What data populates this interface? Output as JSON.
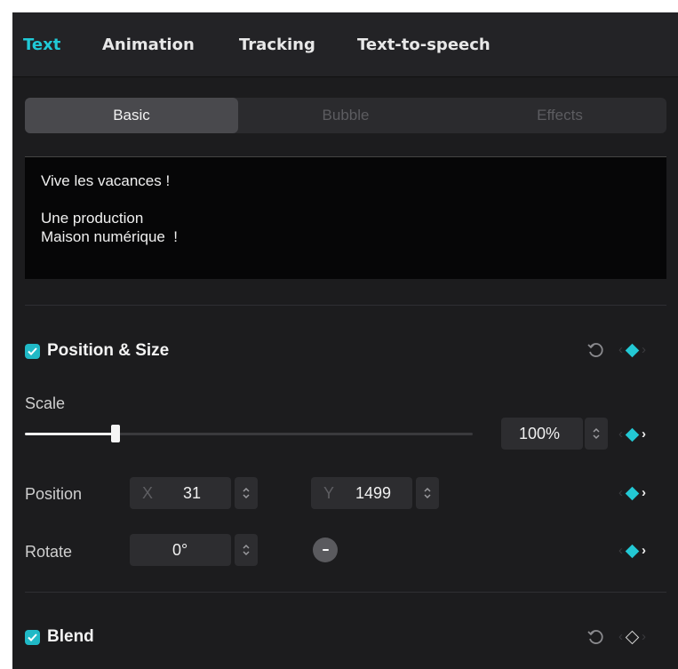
{
  "tabs": [
    {
      "label": "Text",
      "active": true
    },
    {
      "label": "Animation",
      "active": false
    },
    {
      "label": "Tracking",
      "active": false
    },
    {
      "label": "Text-to-speech",
      "active": false
    }
  ],
  "subtabs": [
    {
      "label": "Basic",
      "active": true
    },
    {
      "label": "Bubble",
      "active": false
    },
    {
      "label": "Effects",
      "active": false
    }
  ],
  "text_content": {
    "lines": [
      "Vive les vacances !",
      "",
      "Une production",
      "Maison numérique  !"
    ]
  },
  "position_size": {
    "title": "Position & Size",
    "checked": true,
    "reset_icon": "reset-icon",
    "keyframe_state": "filled",
    "scale": {
      "label": "Scale",
      "value_text": "100%",
      "slider_fraction": 0.2
    },
    "position": {
      "label": "Position",
      "x_prefix": "X",
      "x_value": "31",
      "y_prefix": "Y",
      "y_value": "1499"
    },
    "rotate": {
      "label": "Rotate",
      "value": "0°"
    }
  },
  "blend": {
    "title": "Blend",
    "checked": true,
    "keyframe_state": "outline"
  },
  "colors": {
    "accent": "#20c9d6",
    "panel_bg": "#1c1c1e",
    "keyframe": "#23c8d4"
  }
}
